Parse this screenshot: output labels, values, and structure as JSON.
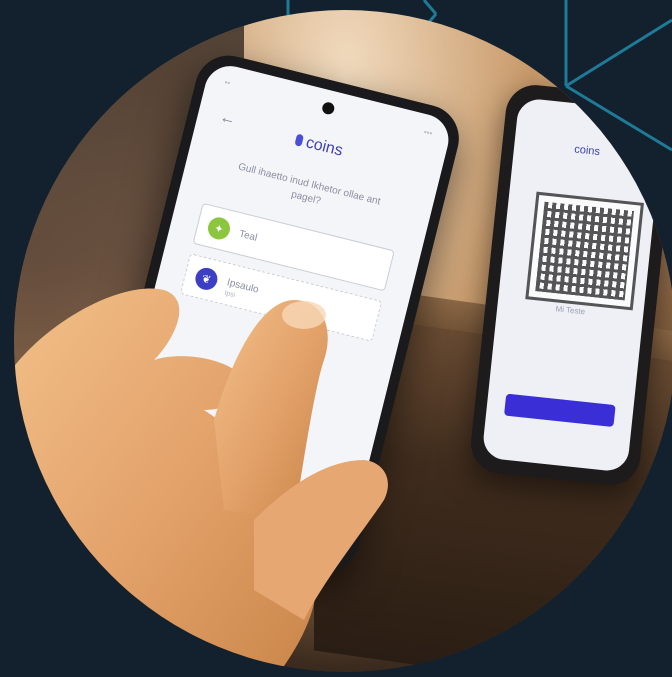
{
  "background_color": "#13202d",
  "line_color": "#1e7a96",
  "front_phone": {
    "back_icon": "arrow-left-icon",
    "brand_name": "coins",
    "question": "Gull ihaetto inud Ikhetor ollae ant pagel?",
    "options": [
      {
        "icon": "gift-icon",
        "label": "Teal",
        "sublabel": ""
      },
      {
        "icon": "leaf-icon",
        "label": "Ipsaulo",
        "sublabel": "Ipsi"
      }
    ]
  },
  "back_phone": {
    "brand_name": "coins",
    "qr_caption": "Mi Teste"
  }
}
